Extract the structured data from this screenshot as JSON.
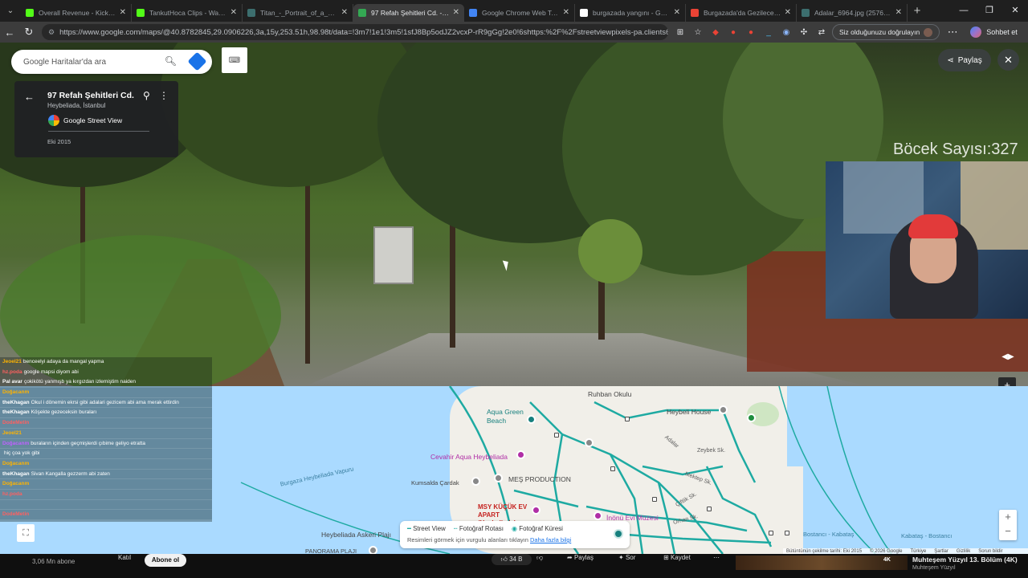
{
  "browser": {
    "tabs": [
      {
        "title": "Overall Revenue - Kick Dash",
        "color": "#53fc18",
        "active": false
      },
      {
        "title": "TankutHoca Clips - Watch L",
        "color": "#53fc18",
        "active": false
      },
      {
        "title": "Titan_-_Portrait_of_a_Wom",
        "color": "#3c6e6e",
        "active": false
      },
      {
        "title": "97 Refah Şehitleri Cd. - Goo",
        "color": "#34a853",
        "active": true
      },
      {
        "title": "Google Chrome Web Tarayı",
        "color": "#4285f4",
        "active": false
      },
      {
        "title": "burgazada yangını - Google",
        "color": "#ffffff",
        "active": false
      },
      {
        "title": "Burgazada'da Gezilecek Yerl",
        "color": "#ea4335",
        "active": false
      },
      {
        "title": "Adalar_6964.jpg (2576×1932)",
        "color": "#3c6e6e",
        "active": false
      }
    ],
    "url": "https://www.google.com/maps/@40.8782845,29.0906226,3a,15y,253.51h,98.98t/data=!3m7!1e1!3m5!1sfJ8Bp5odJZ2vcxP-rR9gGg!2e0!6shttps:%2F%2Fstreetviewpixels-pa.clients6.go...",
    "verify_label": "Siz olduğunuzu doğrulayın",
    "chat_label": "Sohbet et"
  },
  "maps": {
    "search_placeholder": "Google Haritalar'da ara",
    "place_title": "97 Refah Şehitleri Cd.",
    "place_subtitle": "Heybeliada, İstanbul",
    "source_label": "Google Street View",
    "date": "Eki 2015",
    "share_label": "Paylaş",
    "legend": {
      "street_view": "Street View",
      "photo_route": "Fotoğraf Rotası",
      "photo_sphere": "Fotoğraf Küresi",
      "hint": "Resimleri görmek için vurgulu alanları tıklayın",
      "more": "Daha fazla bilgi"
    },
    "map_labels": {
      "ruhban": "Ruhban Okulu",
      "aqua_green": "Aqua Green Beach",
      "heybeli_house": "Heybeli House",
      "cevahir": "Cevahir Aqua Heybeliada",
      "kumsalda": "Kumsalda Çardak",
      "mes": "MEŞ PRODUCTION",
      "msy": "MSY KÜÇÜK EV APART (Heybeliada)",
      "inonu": "İnönü Evi Müzesi",
      "askeri": "Heybeliada Askeri Plajı",
      "panorama": "PANORAMA PLAJI",
      "vapuru": "Burgaza Heybeliada Vapuru",
      "bostanci": "Bostancı - Kabataş",
      "kabatas": "Kabataş - Bostancı",
      "zeybek": "Zeybek Sk.",
      "adalar": "Adalar",
      "mektep": "Mektep Sk.",
      "ciftlik": "Çiftlik Sk.",
      "orhan": "Orhan Sk."
    },
    "attribution": [
      "Bütüntünün çekilme tarihi: Eki 2015",
      "© 2026 Google",
      "Türkiye",
      "Şartlar",
      "Gizlilik",
      "Sorun bildir"
    ]
  },
  "stream": {
    "counter": "Böcek Sayısı:327",
    "chat": [
      {
        "user": "Jeoel21",
        "text": "benceelyi adaya da mangal yapma",
        "color": "#ffb400"
      },
      {
        "user": "hz.poda",
        "text": "google mapsi diyom abi",
        "color": "#ff6060"
      },
      {
        "user": "Pal avar",
        "text": "çokikötü yanmışb ya kırgızdan izlemiştim naiden",
        "color": "#ffffff"
      },
      {
        "user": "Doğacanm",
        "text": "",
        "color": "#ffb400"
      },
      {
        "user": "theKhagan",
        "text": "Okul i dönemin ekrsi gibi adalari gezicem abi ama merak ettirdin",
        "color": "#ffffff"
      },
      {
        "user": "theKhagan",
        "text": "Köşekte gezeceksin buraları",
        "color": "#ffffff"
      },
      {
        "user": "DodeMetin",
        "text": "",
        "color": "#ff6060"
      },
      {
        "user": "Jeoel21",
        "text": "",
        "color": "#ffb400"
      },
      {
        "user": "Doğacanm",
        "text": "buraların içinden geçmişlerdi çıbime geliyo etratta",
        "color": "#c060ff"
      },
      {
        "user": "",
        "text": "hiç çoa yok gibi",
        "color": "#ffffff"
      },
      {
        "user": "Doğacanm",
        "text": "",
        "color": "#ffb400"
      },
      {
        "user": "theKhagan",
        "text": "Sivan Kangalla gezzerm abi zaten",
        "color": "#ffffff"
      },
      {
        "user": "Doğacanm",
        "text": "",
        "color": "#ffb400"
      },
      {
        "user": "hz.poda",
        "text": "",
        "color": "#ff6060"
      },
      {
        "user": "",
        "text": "",
        "color": "#ffffff"
      },
      {
        "user": "DodeMetin",
        "text": "",
        "color": "#ff6060"
      }
    ]
  },
  "youtube": {
    "subs": "3,06 Mn abone",
    "hide": "Katıl",
    "subscribe": "Abone ol",
    "likes": "34 B",
    "share": "Paylaş",
    "ask": "Sor",
    "save": "Kaydet",
    "up_next_title": "Muhteşem Yüzyıl 13. Bölüm (4K)",
    "up_next_channel": "Muhteşem Yüzyıl",
    "up_next_badge": "4K"
  }
}
